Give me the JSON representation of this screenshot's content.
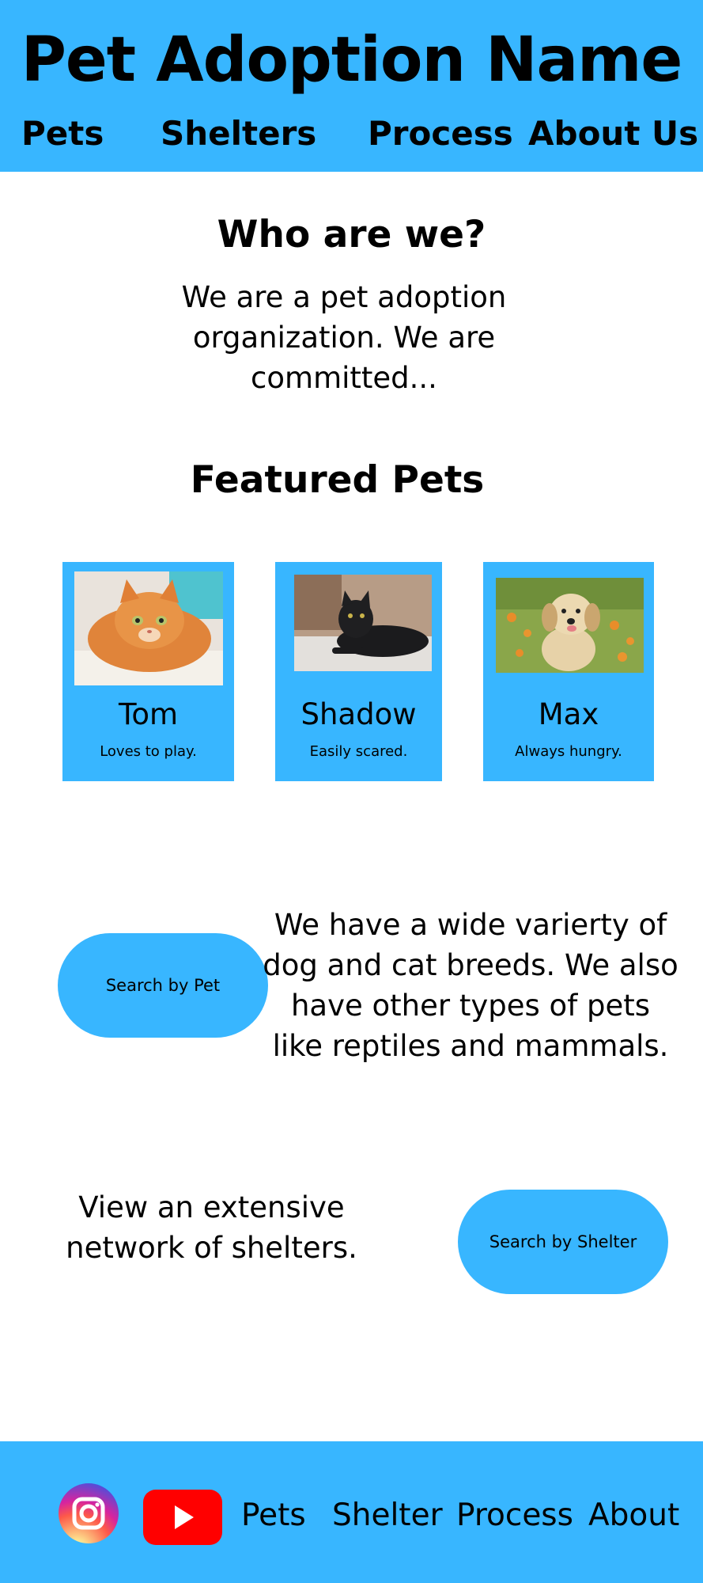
{
  "header": {
    "title": "Pet Adoption Name",
    "nav": [
      "Pets",
      "Shelters",
      "Process",
      "About Us"
    ]
  },
  "about": {
    "heading": "Who are we?",
    "line1": "We are a pet adoption",
    "line2": "organization. We are",
    "line3": "committed..."
  },
  "featured": {
    "heading": "Featured Pets",
    "pets": [
      {
        "name": "Tom",
        "description": "Loves to play."
      },
      {
        "name": "Shadow",
        "description": "Easily scared."
      },
      {
        "name": "Max",
        "description": "Always hungry."
      }
    ]
  },
  "search_pet": {
    "button": "Search by Pet",
    "line1": "We have a wide varierty of",
    "line2": "dog and cat breeds. We also",
    "line3": "have other types of pets",
    "line4": "like reptiles and mammals."
  },
  "search_shelter": {
    "line1": "View an extensive",
    "line2": "network of shelters.",
    "button": "Search by Shelter"
  },
  "footer": {
    "icons": [
      "instagram-icon",
      "youtube-icon"
    ],
    "links": [
      "Pets",
      "Shelter",
      "Process",
      "About"
    ]
  },
  "colors": {
    "primary": "#38b6ff",
    "background": "#ffffff",
    "text": "#000000"
  }
}
